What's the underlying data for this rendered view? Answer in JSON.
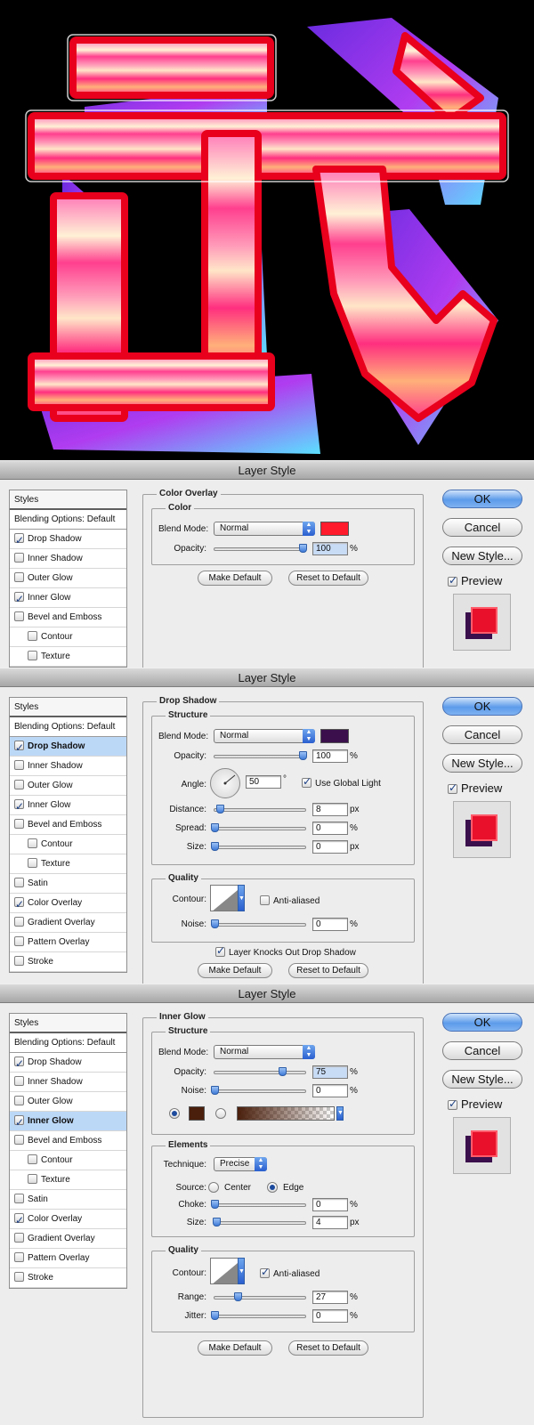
{
  "dialog_title": "Layer Style",
  "buttons": {
    "ok": "OK",
    "cancel": "Cancel",
    "new_style": "New Style...",
    "preview": "Preview",
    "make_default": "Make Default",
    "reset_default": "Reset to Default"
  },
  "styles_header": "Styles",
  "style_items": {
    "blending": "Blending Options: Default",
    "drop_shadow": "Drop Shadow",
    "inner_shadow": "Inner Shadow",
    "outer_glow": "Outer Glow",
    "inner_glow": "Inner Glow",
    "bevel": "Bevel and Emboss",
    "contour": "Contour",
    "texture": "Texture",
    "satin": "Satin",
    "color_overlay": "Color Overlay",
    "gradient_overlay": "Gradient Overlay",
    "pattern_overlay": "Pattern Overlay",
    "stroke": "Stroke"
  },
  "panel1": {
    "section": "Color Overlay",
    "group": "Color",
    "blend_mode_label": "Blend Mode:",
    "blend_mode": "Normal",
    "color": "#ff1a2c",
    "opacity_label": "Opacity:",
    "opacity": "100",
    "opacity_level": 1.0,
    "unit": "%"
  },
  "panel2": {
    "section": "Drop Shadow",
    "structure": "Structure",
    "blend_mode_label": "Blend Mode:",
    "blend_mode": "Normal",
    "color": "#3a0f4c",
    "opacity_label": "Opacity:",
    "opacity": "100",
    "angle_label": "Angle:",
    "angle": "50",
    "degree": "°",
    "use_global_light": "Use Global Light",
    "distance_label": "Distance:",
    "distance": "8",
    "spread_label": "Spread:",
    "spread": "0",
    "size_label": "Size:",
    "size": "0",
    "quality": "Quality",
    "contour_label": "Contour:",
    "anti_aliased": "Anti-aliased",
    "noise_label": "Noise:",
    "noise": "0",
    "knocks_out": "Layer Knocks Out Drop Shadow",
    "px": "px",
    "pct": "%"
  },
  "panel3": {
    "section": "Inner Glow",
    "structure": "Structure",
    "blend_mode_label": "Blend Mode:",
    "blend_mode": "Normal",
    "opacity_label": "Opacity:",
    "opacity": "75",
    "noise_label": "Noise:",
    "noise": "0",
    "glow_color": "#4a1f0c",
    "elements": "Elements",
    "technique_label": "Technique:",
    "technique": "Precise",
    "source_label": "Source:",
    "center": "Center",
    "edge": "Edge",
    "choke_label": "Choke:",
    "choke": "0",
    "size_label": "Size:",
    "size": "4",
    "quality": "Quality",
    "contour_label": "Contour:",
    "anti_aliased": "Anti-aliased",
    "range_label": "Range:",
    "range": "27",
    "jitter_label": "Jitter:",
    "jitter": "0",
    "px": "px",
    "pct": "%"
  }
}
